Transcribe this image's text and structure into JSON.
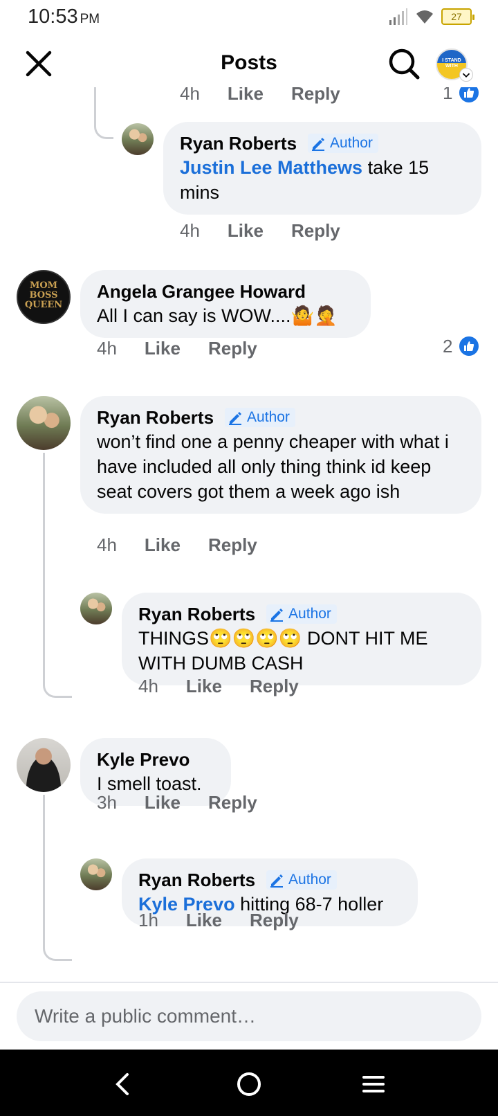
{
  "status_bar": {
    "time": "10:53",
    "ampm": "PM",
    "battery": "27"
  },
  "header": {
    "title": "Posts",
    "profile_text": "I STAND WITH"
  },
  "top_partial": {
    "time": "4h",
    "like": "Like",
    "reply": "Reply",
    "reaction_count": "1"
  },
  "comments": [
    {
      "author": "Ryan Roberts",
      "badge": "Author",
      "mention": "Justin Lee Matthews",
      "text": " take 15 mins",
      "time": "4h",
      "like": "Like",
      "reply": "Reply"
    },
    {
      "author": "Angela Grangee Howard",
      "avatar_text": "MOM BOSS QUEEN",
      "text": "All I can say is WOW....🤷🤦",
      "time": "4h",
      "like": "Like",
      "reply": "Reply",
      "reaction_count": "2"
    },
    {
      "author": "Ryan Roberts",
      "badge": "Author",
      "text": "won’t find one a penny cheaper with what i have included all only thing think id keep seat covers got them a week ago ish",
      "time": "4h",
      "like": "Like",
      "reply": "Reply"
    },
    {
      "author": "Ryan Roberts",
      "badge": "Author",
      "text": "THINGS🙄🙄🙄🙄 DONT HIT ME WITH DUMB CASH",
      "time": "4h",
      "like": "Like",
      "reply": "Reply"
    },
    {
      "author": "Kyle Prevo",
      "text": "I smell toast.",
      "time": "3h",
      "like": "Like",
      "reply": "Reply"
    },
    {
      "author": "Ryan Roberts",
      "badge": "Author",
      "mention": "Kyle Prevo",
      "text": " hitting 68-7 holler",
      "time": "1h",
      "like": "Like",
      "reply": "Reply"
    }
  ],
  "composer": {
    "placeholder": "Write a public comment…"
  },
  "colors": {
    "accent": "#1b74e4",
    "bubble": "#f0f2f5",
    "meta": "#65676b"
  }
}
